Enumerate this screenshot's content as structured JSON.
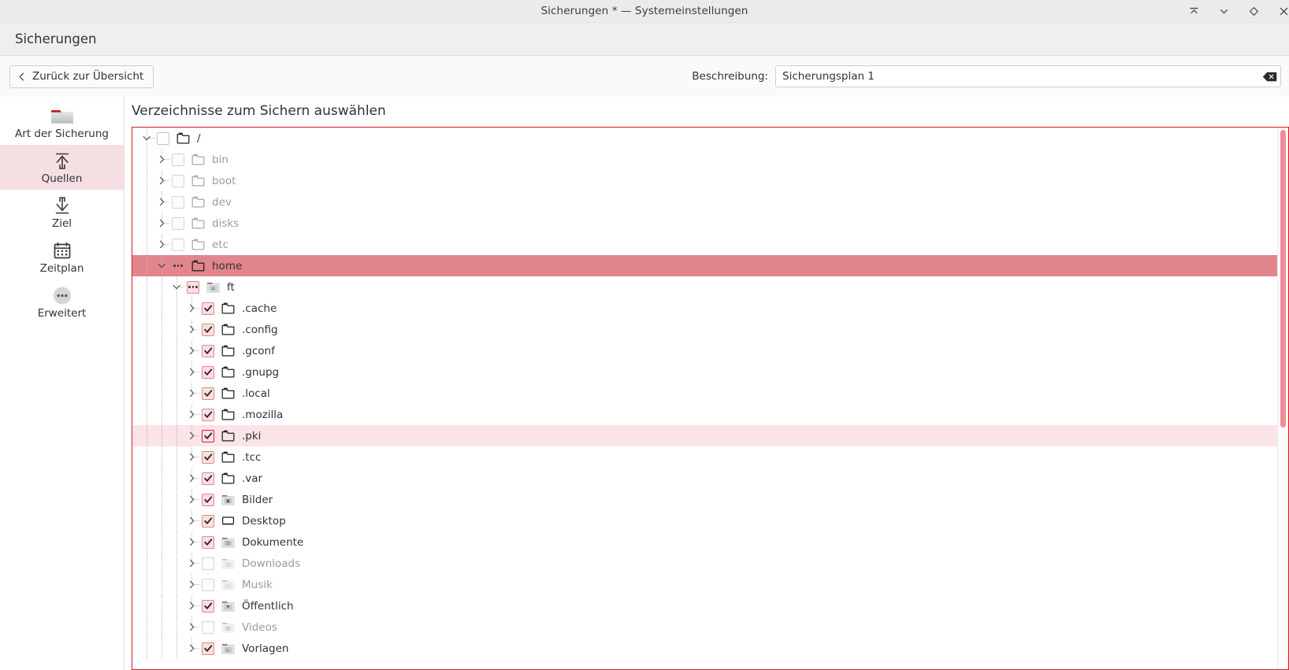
{
  "window": {
    "title": "Sicherungen * — Systemeinstellungen",
    "controls": [
      {
        "name": "minimize-button",
        "icon": "collapse-up-icon"
      },
      {
        "name": "maximize-button",
        "icon": "chevron-down-icon"
      },
      {
        "name": "restore-button",
        "icon": "diamond-icon"
      },
      {
        "name": "close-button",
        "icon": "close-icon"
      }
    ]
  },
  "header": {
    "title": "Sicherungen"
  },
  "toolbar": {
    "back_label": "Zurück zur Übersicht",
    "back_icon": "chevron-left-icon",
    "description_label": "Beschreibung:",
    "description_value": "Sicherungsplan 1",
    "description_placeholder": "",
    "clear_icon": "clear-backspace-icon"
  },
  "sidebar": {
    "items": [
      {
        "label": "Art der Sicherung",
        "icon": "folder-red-tab-icon",
        "active": false
      },
      {
        "label": "Quellen",
        "icon": "upload-arrow-icon",
        "active": true
      },
      {
        "label": "Ziel",
        "icon": "download-arrow-icon",
        "active": false
      },
      {
        "label": "Zeitplan",
        "icon": "calendar-icon",
        "active": false
      },
      {
        "label": "Erweitert",
        "icon": "ellipsis-circle-icon",
        "active": false
      }
    ]
  },
  "main": {
    "title": "Verzeichnisse zum Sichern auswählen",
    "tree": [
      {
        "label": "/",
        "depth": 0,
        "check": "empty",
        "icon": "folder-icon",
        "expanded": true,
        "state": "normal"
      },
      {
        "label": "bin",
        "depth": 1,
        "check": "empty",
        "icon": "folder-icon",
        "expanded": false,
        "state": "dim"
      },
      {
        "label": "boot",
        "depth": 1,
        "check": "empty",
        "icon": "folder-icon",
        "expanded": false,
        "state": "dim"
      },
      {
        "label": "dev",
        "depth": 1,
        "check": "empty",
        "icon": "folder-icon",
        "expanded": false,
        "state": "dim"
      },
      {
        "label": "disks",
        "depth": 1,
        "check": "empty",
        "icon": "folder-icon",
        "expanded": false,
        "state": "dim"
      },
      {
        "label": "etc",
        "depth": 1,
        "check": "empty",
        "icon": "folder-icon",
        "expanded": false,
        "state": "dim"
      },
      {
        "label": "home",
        "depth": 1,
        "check": "partial-plain",
        "icon": "folder-icon",
        "expanded": true,
        "state": "selected"
      },
      {
        "label": "ft",
        "depth": 2,
        "check": "partial",
        "icon": "folder-home-icon",
        "expanded": true,
        "state": "normal"
      },
      {
        "label": ".cache",
        "depth": 3,
        "check": "checked",
        "icon": "folder-icon",
        "expanded": false,
        "state": "normal"
      },
      {
        "label": ".config",
        "depth": 3,
        "check": "checked",
        "icon": "folder-icon",
        "expanded": false,
        "state": "normal"
      },
      {
        "label": ".gconf",
        "depth": 3,
        "check": "checked",
        "icon": "folder-icon",
        "expanded": false,
        "state": "normal"
      },
      {
        "label": ".gnupg",
        "depth": 3,
        "check": "checked",
        "icon": "folder-icon",
        "expanded": false,
        "state": "normal"
      },
      {
        "label": ".local",
        "depth": 3,
        "check": "checked",
        "icon": "folder-icon",
        "expanded": false,
        "state": "normal"
      },
      {
        "label": ".mozilla",
        "depth": 3,
        "check": "checked",
        "icon": "folder-icon",
        "expanded": false,
        "state": "normal"
      },
      {
        "label": ".pki",
        "depth": 3,
        "check": "checked-strong",
        "icon": "folder-icon",
        "expanded": false,
        "state": "hover"
      },
      {
        "label": ".tcc",
        "depth": 3,
        "check": "checked",
        "icon": "folder-icon",
        "expanded": false,
        "state": "normal"
      },
      {
        "label": ".var",
        "depth": 3,
        "check": "checked",
        "icon": "folder-icon",
        "expanded": false,
        "state": "normal"
      },
      {
        "label": "Bilder",
        "depth": 3,
        "check": "checked",
        "icon": "folder-pictures-icon",
        "expanded": false,
        "state": "normal"
      },
      {
        "label": "Desktop",
        "depth": 3,
        "check": "checked",
        "icon": "desktop-icon",
        "expanded": false,
        "state": "normal"
      },
      {
        "label": "Dokumente",
        "depth": 3,
        "check": "checked",
        "icon": "folder-documents-icon",
        "expanded": false,
        "state": "normal"
      },
      {
        "label": "Downloads",
        "depth": 3,
        "check": "empty",
        "icon": "folder-downloads-icon",
        "expanded": false,
        "state": "dim"
      },
      {
        "label": "Musik",
        "depth": 3,
        "check": "empty",
        "icon": "folder-music-icon",
        "expanded": false,
        "state": "dim"
      },
      {
        "label": "Öffentlich",
        "depth": 3,
        "check": "checked",
        "icon": "folder-public-icon",
        "expanded": false,
        "state": "normal"
      },
      {
        "label": "Videos",
        "depth": 3,
        "check": "empty",
        "icon": "folder-videos-icon",
        "expanded": false,
        "state": "dim"
      },
      {
        "label": "Vorlagen",
        "depth": 3,
        "check": "checked",
        "icon": "folder-templates-icon",
        "expanded": false,
        "state": "normal"
      }
    ]
  },
  "colors": {
    "accent_red": "#d11b28",
    "selection_rose": "#e2858c",
    "hover_rose": "#fbe4e6",
    "sidebar_active": "#f6dfe3",
    "scrollbar_thumb": "#ef8e98",
    "titlebar_bg": "#ebebeb",
    "header_bg": "#efefee"
  }
}
